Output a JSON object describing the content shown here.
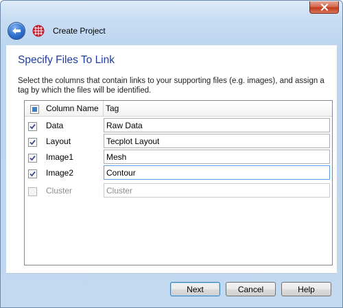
{
  "window": {
    "title": "Create Project"
  },
  "page": {
    "heading": "Specify Files To Link",
    "description": "Select the columns that contain links to your supporting files (e.g. images), and assign a tag by which the files will be identified."
  },
  "table": {
    "headers": {
      "column_name": "Column Name",
      "tag": "Tag"
    },
    "rows": [
      {
        "checked": true,
        "name": "Data",
        "tag": "Raw Data",
        "enabled": true
      },
      {
        "checked": true,
        "name": "Layout",
        "tag": "Tecplot Layout",
        "enabled": true
      },
      {
        "checked": true,
        "name": "Image1",
        "tag": "Mesh",
        "enabled": true
      },
      {
        "checked": true,
        "name": "Image2",
        "tag": "Contour",
        "enabled": true
      },
      {
        "checked": false,
        "name": "Cluster",
        "tag": "Cluster",
        "enabled": false
      }
    ]
  },
  "buttons": {
    "next": "Next",
    "cancel": "Cancel",
    "help": "Help"
  },
  "colors": {
    "heading": "#1f3d9b",
    "close": "#c1391b",
    "back": "#2f6fcf",
    "checkbox_fill": "#3a83c6"
  },
  "icons": {
    "back": "back-arrow-icon",
    "app": "tecplot-grid-icon",
    "close": "close-icon"
  }
}
